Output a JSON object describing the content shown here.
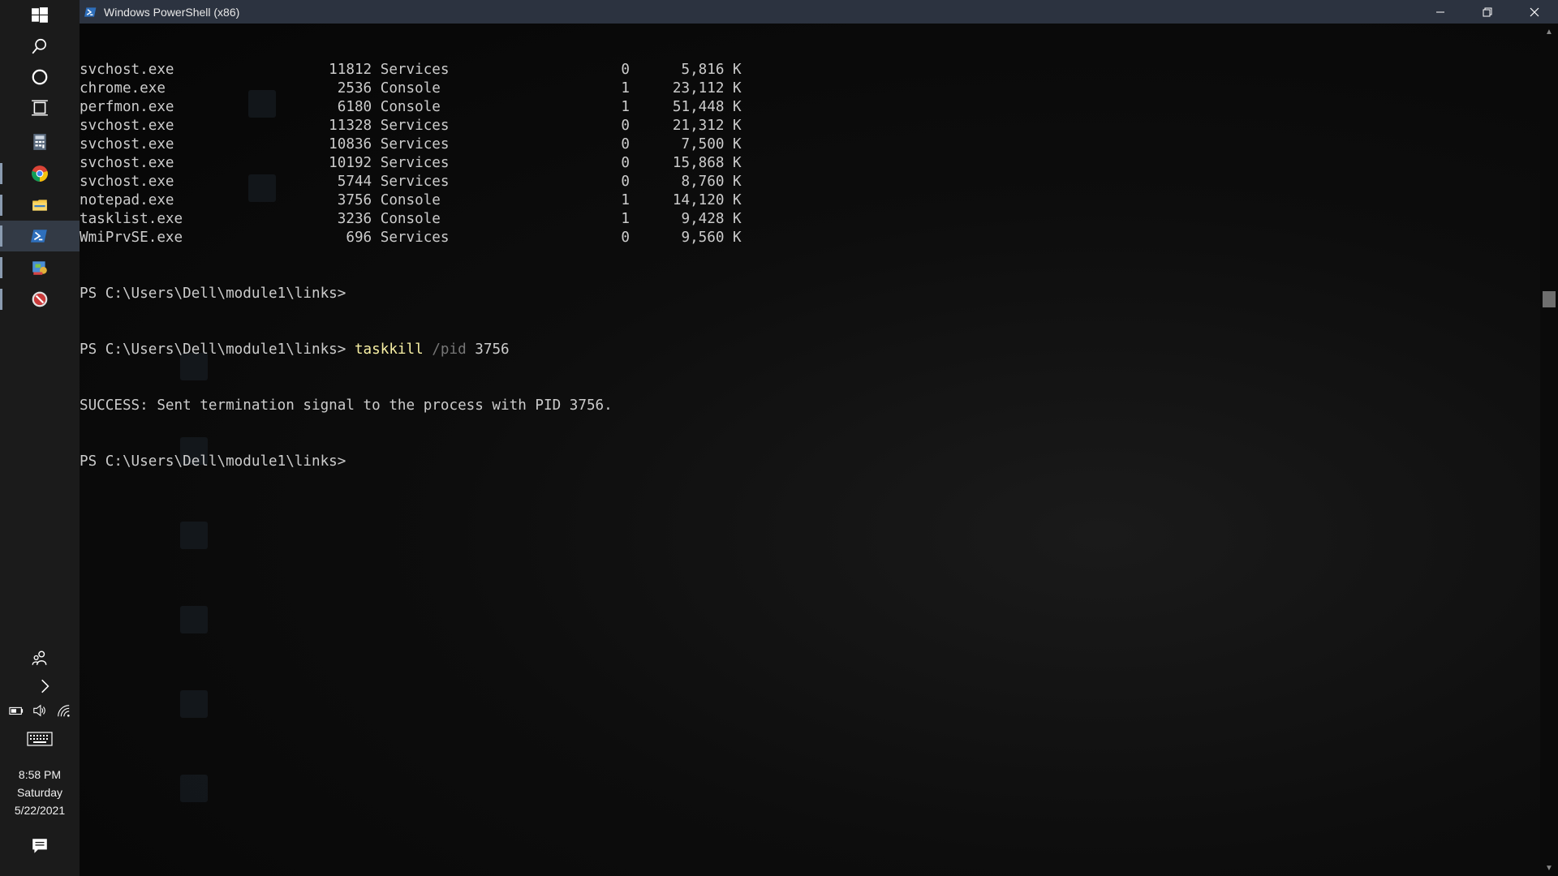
{
  "window": {
    "title": "Windows PowerShell (x86)"
  },
  "taskbar": {
    "icons": [
      "windows-logo-icon",
      "search-icon",
      "cortana-icon",
      "task-view-icon",
      "calculator-icon",
      "chrome-icon",
      "file-explorer-icon",
      "powershell-icon",
      "control-panel-icon",
      "app-icon"
    ],
    "tray": [
      "people-icon",
      "chevron-right-icon",
      "battery-icon",
      "volume-icon",
      "wifi-icon",
      "keyboard-icon",
      "action-center-icon"
    ]
  },
  "clock": {
    "time": "8:58 PM",
    "day": "Saturday",
    "date": "5/22/2021"
  },
  "console": {
    "process_rows": [
      {
        "name": "svchost.exe",
        "pid": "11812",
        "session": "Services",
        "num": "0",
        "mem": "5,816 K"
      },
      {
        "name": "chrome.exe",
        "pid": "2536",
        "session": "Console",
        "num": "1",
        "mem": "23,112 K"
      },
      {
        "name": "perfmon.exe",
        "pid": "6180",
        "session": "Console",
        "num": "1",
        "mem": "51,448 K"
      },
      {
        "name": "svchost.exe",
        "pid": "11328",
        "session": "Services",
        "num": "0",
        "mem": "21,312 K"
      },
      {
        "name": "svchost.exe",
        "pid": "10836",
        "session": "Services",
        "num": "0",
        "mem": "7,500 K"
      },
      {
        "name": "svchost.exe",
        "pid": "10192",
        "session": "Services",
        "num": "0",
        "mem": "15,868 K"
      },
      {
        "name": "svchost.exe",
        "pid": "5744",
        "session": "Services",
        "num": "0",
        "mem": "8,760 K"
      },
      {
        "name": "notepad.exe",
        "pid": "3756",
        "session": "Console",
        "num": "1",
        "mem": "14,120 K"
      },
      {
        "name": "tasklist.exe",
        "pid": "3236",
        "session": "Console",
        "num": "1",
        "mem": "9,428 K"
      },
      {
        "name": "WmiPrvSE.exe",
        "pid": "696",
        "session": "Services",
        "num": "0",
        "mem": "9,560 K"
      }
    ],
    "prompt": "PS C:\\Users\\Dell\\module1\\links>",
    "command_name": "taskkill",
    "command_param": "/pid",
    "command_arg": "3756",
    "success_message": "SUCCESS: Sent termination signal to the process with PID 3756."
  },
  "colors": {
    "console_text": "#cccccc",
    "command_yellow": "#f9f1a5",
    "parameter_gray": "#767676",
    "titlebar": "#2c3340"
  }
}
